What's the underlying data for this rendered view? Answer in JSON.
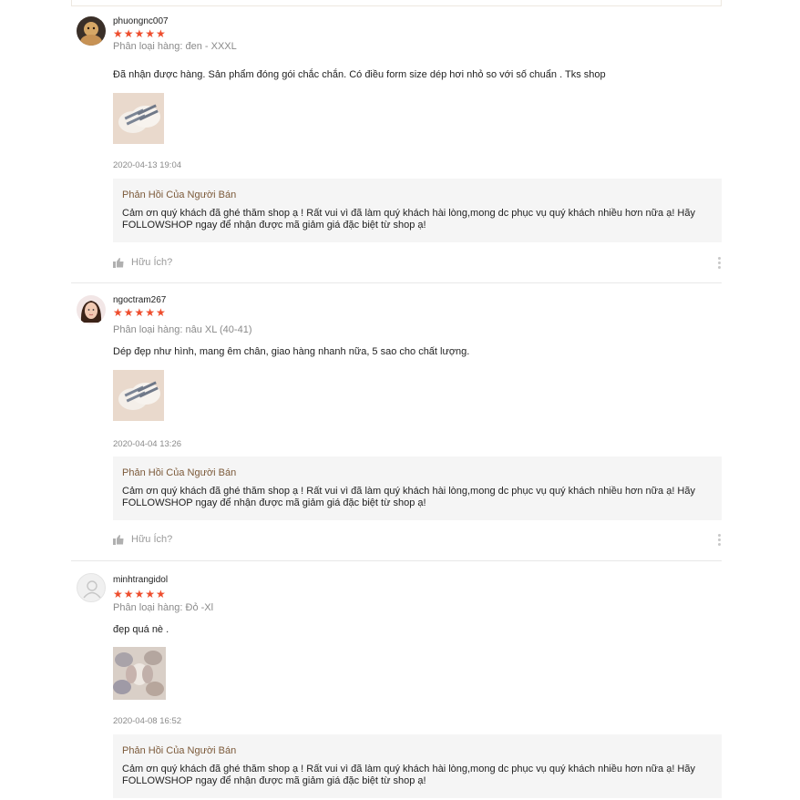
{
  "colors": {
    "star": "#ee4d2d",
    "reply_title": "#7c5a3a",
    "reply_bg": "#f5f5f5",
    "muted": "#8a8a8a"
  },
  "reviews": [
    {
      "username": "phuongnc007",
      "stars": "★★★★★",
      "rating": 5,
      "variant": "Phân loại hàng: đen - XXXL",
      "comment": "Đã nhận được hàng. Sản phẩm đóng gói chắc chắn. Có điều form size dép hơi nhỏ so với số chuẩn . Tks shop",
      "timestamp": "2020-04-13 19:04",
      "reply_title": "Phản Hồi Của Người Bán",
      "reply_line1": "Cảm ơn quý khách đã ghé thăm shop ạ ! Rất vui vì đã làm quý khách hài lòng,mong dc phục vụ quý khách nhiều hơn nữa ạ! Hãy",
      "reply_line2": "FOLLOWSHOP ngay để nhận được mã giảm giá đặc biệt từ shop ạ!",
      "helpful": "Hữu Ích?",
      "avatar_icon": "avatar-photo-icon",
      "thumb_icon": "slipper-photo-icon"
    },
    {
      "username": "ngoctram267",
      "stars": "★★★★★",
      "rating": 5,
      "variant": "Phân loại hàng: nâu XL (40-41)",
      "comment": "Dép đẹp như hình, mang êm chân, giao hàng nhanh nữa, 5 sao cho chất lượng.",
      "timestamp": "2020-04-04 13:26",
      "reply_title": "Phản Hồi Của Người Bán",
      "reply_line1": "Cảm ơn quý khách đã ghé thăm shop ạ ! Rất vui vì đã làm quý khách hài lòng,mong dc phục vụ quý khách nhiều hơn nữa ạ! Hãy",
      "reply_line2": "FOLLOWSHOP ngay để nhận được mã giảm giá đặc biệt từ shop ạ!",
      "helpful": "Hữu Ích?",
      "avatar_icon": "avatar-photo-icon",
      "thumb_icon": "slipper-photo-icon"
    },
    {
      "username": "minhtrangidol",
      "stars": "★★★★★",
      "rating": 5,
      "variant": "Phân loại hàng: Đỏ -Xl",
      "comment": "đẹp quá nè .",
      "timestamp": "2020-04-08 16:52",
      "reply_title": "Phản Hồi Của Người Bán",
      "reply_line1": "Cảm ơn quý khách đã ghé thăm shop ạ ! Rất vui vì đã làm quý khách hài lòng,mong dc phục vụ quý khách nhiều hơn nữa ạ! Hãy",
      "reply_line2": "FOLLOWSHOP ngay để nhận được mã giảm giá đặc biệt từ shop ạ!",
      "avatar_icon": "default-avatar-icon",
      "thumb_icon": "slippers-collage-photo-icon"
    }
  ]
}
